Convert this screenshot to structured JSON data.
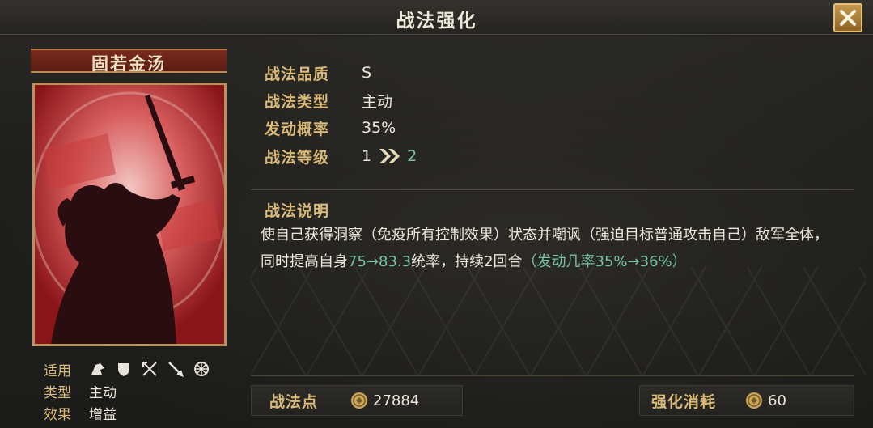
{
  "header": {
    "title": "战法强化"
  },
  "skill": {
    "name": "固若金汤",
    "attributes": [
      {
        "key": "适用",
        "icons": [
          "cavalry-icon",
          "shield-icon",
          "crossbow-icon",
          "spear-icon",
          "wheel-icon"
        ]
      },
      {
        "key": "类型",
        "value": "主动"
      },
      {
        "key": "效果",
        "value": "增益"
      }
    ]
  },
  "info": {
    "quality_label": "战法品质",
    "quality_value": "S",
    "type_label": "战法类型",
    "type_value": "主动",
    "rate_label": "发动概率",
    "rate_value": "35%",
    "level_label": "战法等级",
    "level_current": "1",
    "level_next": "2"
  },
  "description": {
    "title": "战法说明",
    "part1": "使自己获得洞察（免疫所有控制效果）状态并嘲讽（强迫目标普通攻击自己）敌军全体，同时提高自身",
    "part2": "75→83.3",
    "part3": "统率，持续2回合",
    "part4": "（发动几率35%→36%）"
  },
  "footer": {
    "points_label": "战法点",
    "points_value": "27884",
    "cost_label": "强化消耗",
    "cost_value": "60"
  },
  "colors": {
    "accent_gold": "#d9b978",
    "upgrade_green": "#76c2a3",
    "card_red": "#9c1f23"
  }
}
